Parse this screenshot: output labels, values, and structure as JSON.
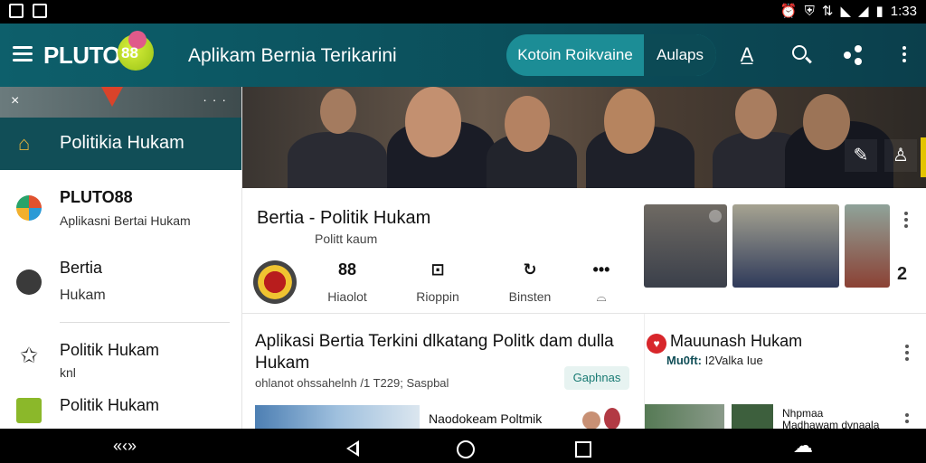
{
  "status_bar": {
    "time": "1:33",
    "left_icons": [
      "image-icon",
      "image-icon"
    ],
    "right_icons": [
      "alarm-icon",
      "shield-icon",
      "data-icon",
      "wifi-icon",
      "signal-icon",
      "battery-icon"
    ]
  },
  "app_bar": {
    "brand": "PLUTO",
    "brand_badge": "88",
    "title": "Aplikam Bernia Terikarini",
    "pill_primary": "Kotoin Roikvaine",
    "pill_secondary": "Aulaps",
    "actions": [
      "text-format-icon",
      "search-icon",
      "share-icon",
      "more-icon"
    ]
  },
  "drawer": {
    "top_close": "×",
    "top_dots": "· · ·",
    "selected": {
      "label": "Politikia Hukam",
      "icon": "home-icon"
    },
    "items": [
      {
        "title": "PLUTO88",
        "subtitle": "Aplikasni Bertai Hukam",
        "icon": "app-logo-icon"
      },
      {
        "title": "Bertia",
        "subtitle": "Hukam",
        "icon": "info-icon"
      },
      {
        "title": "Politik Hukam",
        "subtitle": "knl",
        "icon": "star-icon"
      },
      {
        "title": "Politik Hukam",
        "subtitle": "",
        "icon": "chart-icon"
      }
    ]
  },
  "hero": {
    "actions": [
      "edit-icon",
      "person-icon"
    ]
  },
  "card1": {
    "title": "Bertia - Politik Hukam",
    "subtitle": "Politt kaum",
    "stats": [
      {
        "num": "88",
        "label": "Hiaolot"
      },
      {
        "num": "",
        "label": "Rioppin"
      },
      {
        "num": "",
        "label": "Binsten"
      },
      {
        "num": "",
        "label": ""
      }
    ]
  },
  "side_panel": {
    "arrow": "2"
  },
  "card2": {
    "title": "Aplikasi Bertia Terkini dlkatang Politk dam dulla Hukam",
    "meta": "ohlanot ohssahelnh /1 T229; Saspbal",
    "chip": "Gaphnas",
    "bottom_text": "Naodokeam Poltmik"
  },
  "card3": {
    "title": "Mauunash Hukam",
    "meta_bold": "Mu0ft:",
    "meta_rest": "I2Valka Iue",
    "bottom_title": "Nhpmaa",
    "bottom_sub": "Madhawam dvnaala"
  },
  "nav_bar": {
    "left_label": "«‹»",
    "buttons": [
      "back-icon",
      "home-icon",
      "recents-icon",
      "cloud-icon"
    ]
  },
  "colors": {
    "app_bar": "#0d5f6b",
    "drawer_selected": "#114e57",
    "pill": "#1c8d96",
    "accent_yellow": "#e3c400",
    "badge_green": "#98c216"
  }
}
